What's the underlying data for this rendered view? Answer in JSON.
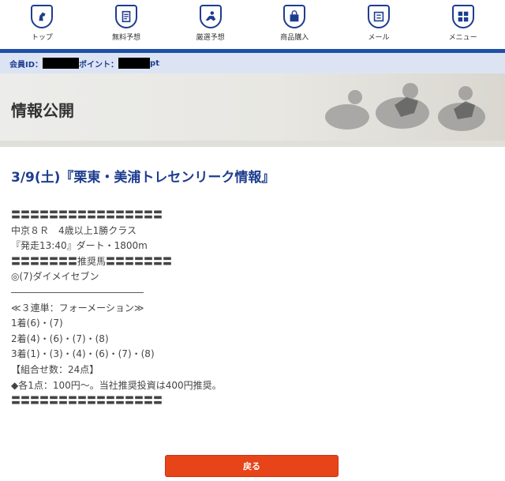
{
  "nav": [
    {
      "label": "トップ",
      "icon": "horse-head-icon"
    },
    {
      "label": "無料予想",
      "icon": "document-icon"
    },
    {
      "label": "厳選予想",
      "icon": "jockey-icon"
    },
    {
      "label": "商品購入",
      "icon": "shopping-bag-icon"
    },
    {
      "label": "メール",
      "icon": "mail-icon"
    },
    {
      "label": "メニュー",
      "icon": "grid-icon"
    }
  ],
  "member": {
    "id_label": "会員ID：",
    "points_label": "ポイント：",
    "points_unit": "pt"
  },
  "page_title": "情報公開",
  "article": {
    "title": "3/9(土)『栗東・美浦トレセンリーク情報』",
    "lines": [
      "〓〓〓〓〓〓〓〓〓〓〓〓〓〓〓〓",
      "中京８Ｒ　4歳以上1勝クラス",
      "『発走13:40』ダート・1800m",
      "〓〓〓〓〓〓〓推奨馬〓〓〓〓〓〓〓",
      "◎(7)ダイメイセブン",
      "――――――――――――――",
      "≪３連単：フォーメーション≫",
      "1着(6)・(7)",
      "2着(4)・(6)・(7)・(8)",
      "3着(1)・(3)・(4)・(6)・(7)・(8)",
      "【組合せ数：24点】",
      "◆各1点：100円〜。当社推奨投資は400円推奨。",
      "〓〓〓〓〓〓〓〓〓〓〓〓〓〓〓〓"
    ]
  },
  "back_label": "戻る",
  "colors": {
    "brand": "#1e3d8f",
    "accent": "#e8441a"
  }
}
